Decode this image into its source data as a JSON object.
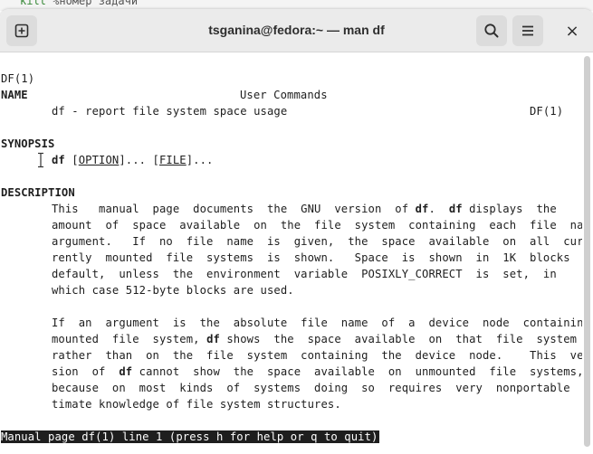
{
  "background_terminal": {
    "keyword": "kill",
    "rest": " %номер задачи"
  },
  "window": {
    "title": "tsganina@fedora:~ — man df",
    "icons": {
      "new_tab": "new-tab-icon",
      "search": "search-icon",
      "menu": "hamburger-menu-icon",
      "close": "close-icon"
    },
    "close_glyph": "×"
  },
  "man": {
    "header_left": "DF(1)",
    "header_center": "User Commands",
    "header_right": "DF(1)",
    "name_heading": "NAME",
    "name_text": "df - report file system space usage",
    "synopsis_heading": "SYNOPSIS",
    "synopsis": {
      "cmd": "df",
      "sp1": " [",
      "option": "OPTION",
      "mid": "]... [",
      "file": "FILE",
      "end": "]..."
    },
    "description_heading": "DESCRIPTION",
    "desc1": {
      "l1a": "This   manual  page  documents  the  GNU  version  of ",
      "l1b": "df",
      "l1c": ".  ",
      "l1d": "df",
      "l1e": " displays  the",
      "l2": "amount  of  space  available  on  the  file  system  containing  each  file  name",
      "l3": "argument.   If  no  file  name  is  given,  the  space  available  on  all  cur-",
      "l4": "rently  mounted  file  systems  is  shown.   Space  is  shown  in  1K  blocks  by",
      "l5": "default,  unless  the  environment  variable  POSIXLY_CORRECT  is  set,  in",
      "l6": "which case 512-byte blocks are used."
    },
    "desc2": {
      "l1": "If  an  argument  is  the  absolute  file  name  of  a  device  node  containing  a",
      "l2a": "mounted  file  system, ",
      "l2b": "df",
      "l2c": " shows  the  space  available  on  that  file  system",
      "l3": "rather  than  on  the  file  system  containing  the  device  node.    This  ver-",
      "l4a": "sion  of  ",
      "l4b": "df",
      "l4c": " cannot  show  the  space  available  on  unmounted  file  systems,",
      "l5": "because  on  most  kinds  of  systems  doing  so  requires  very  nonportable  in-",
      "l6": "timate knowledge of file system structures."
    },
    "status_line": "Manual page df(1) line 1 (press h for help or q to quit)"
  }
}
